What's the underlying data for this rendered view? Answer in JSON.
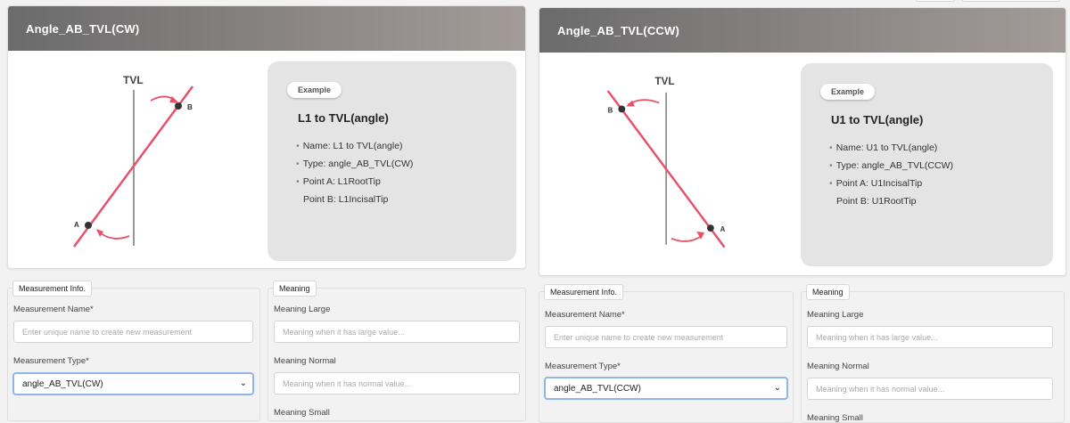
{
  "left": {
    "title": "Angle_AB_TVL(CW)",
    "diagram": {
      "axis_label": "TVL",
      "point_a": "A",
      "point_b": "B"
    },
    "example": {
      "badge": "Example",
      "title": "L1 to TVL(angle)",
      "name": "Name: L1 to TVL(angle)",
      "type": "Type: angle_AB_TVL(CW)",
      "point_a": "Point A: L1RootTip",
      "point_b": "Point B: L1IncisalTip"
    },
    "measurement_info": {
      "legend": "Measurement Info.",
      "name_label": "Measurement Name*",
      "name_placeholder": "Enter unique name to create new measurement",
      "type_label": "Measurement Type*",
      "type_value": "angle_AB_TVL(CW)"
    },
    "meaning": {
      "legend": "Meaning",
      "large_label": "Meaning Large",
      "large_placeholder": "Meaning when it has large value...",
      "normal_label": "Meaning Normal",
      "normal_placeholder": "Meaning when it has normal value...",
      "small_label": "Meaning Small"
    }
  },
  "right": {
    "title": "Angle_AB_TVL(CCW)",
    "diagram": {
      "axis_label": "TVL",
      "point_a": "A",
      "point_b": "B"
    },
    "example": {
      "badge": "Example",
      "title": "U1 to TVL(angle)",
      "name": "Name: U1 to TVL(angle)",
      "type": "Type: angle_AB_TVL(CCW)",
      "point_a": "Point A: U1IncisalTip",
      "point_b": "Point B: U1RootTip"
    },
    "measurement_info": {
      "legend": "Measurement Info.",
      "name_label": "Measurement Name*",
      "name_placeholder": "Enter unique name to create new measurement",
      "type_label": "Measurement Type*",
      "type_value": "angle_AB_TVL(CCW)"
    },
    "meaning": {
      "legend": "Meaning",
      "large_label": "Meaning Large",
      "large_placeholder": "Meaning when it has large value...",
      "normal_label": "Meaning Normal",
      "normal_placeholder": "Meaning when it has normal value...",
      "small_label": "Meaning Small"
    }
  },
  "colors": {
    "line": "#e8506a",
    "axis": "#777777",
    "point": "#333333",
    "select_border": "#8fb6e8"
  }
}
